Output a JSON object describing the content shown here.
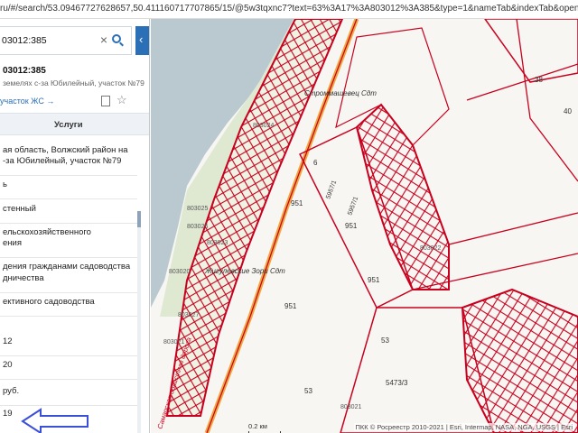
{
  "browser": {
    "url": "ru/#/search/53.09467727628657,50.411160717707865/15/@5w3tqxnc7?text=63%3A17%3A803012%3A385&type=1&nameTab&indexTab&opened"
  },
  "search": {
    "value": "03012:385"
  },
  "parcel": {
    "title": "03012:385",
    "subtitle": "земелях с-за Юбилейный, участок №79",
    "link": "участок ЖС →"
  },
  "tabs": {
    "services": "Услуги"
  },
  "details": [
    "ая область, Волжский район на",
    "-за Юбилейный, участок №79",
    "ь",
    "стенный",
    "ельскохозяйственного",
    "ения",
    "дения гражданами садоводства",
    "дничества",
    "ективного садоводства",
    "12",
    "20",
    "руб.",
    "19"
  ],
  "map": {
    "labels": {
      "strommashevets": "Строммашевец Сдт",
      "zarya": "Жигулевские Зори Сдт",
      "road": "Самарская областная дорога",
      "n951a": "951",
      "n951b": "951",
      "n951c": "951",
      "n951d": "951",
      "n53a": "53",
      "n53b": "53",
      "n38": "38",
      "n40": "40",
      "n6": "6",
      "n5957": "5957/1",
      "n59571": "5957/1",
      "n5473": "5473/3",
      "b803024": "803024",
      "b803025": "803025",
      "b803023": "803023",
      "b803022": "803022",
      "b803021": "803021",
      "b803020": "803020",
      "b803021b": "803021",
      "b803027": "803027",
      "b803026": "803026"
    },
    "scale": "0.2 км",
    "attribution": "ПКК © Росреестр 2010-2021 | Esri, Intermap, NASA, NGA, USGS | Esri"
  },
  "colors": {
    "accent": "#2b6fb6",
    "parcel": "#c8001e",
    "road": "#f0a640",
    "water": "#b9c9cf"
  }
}
